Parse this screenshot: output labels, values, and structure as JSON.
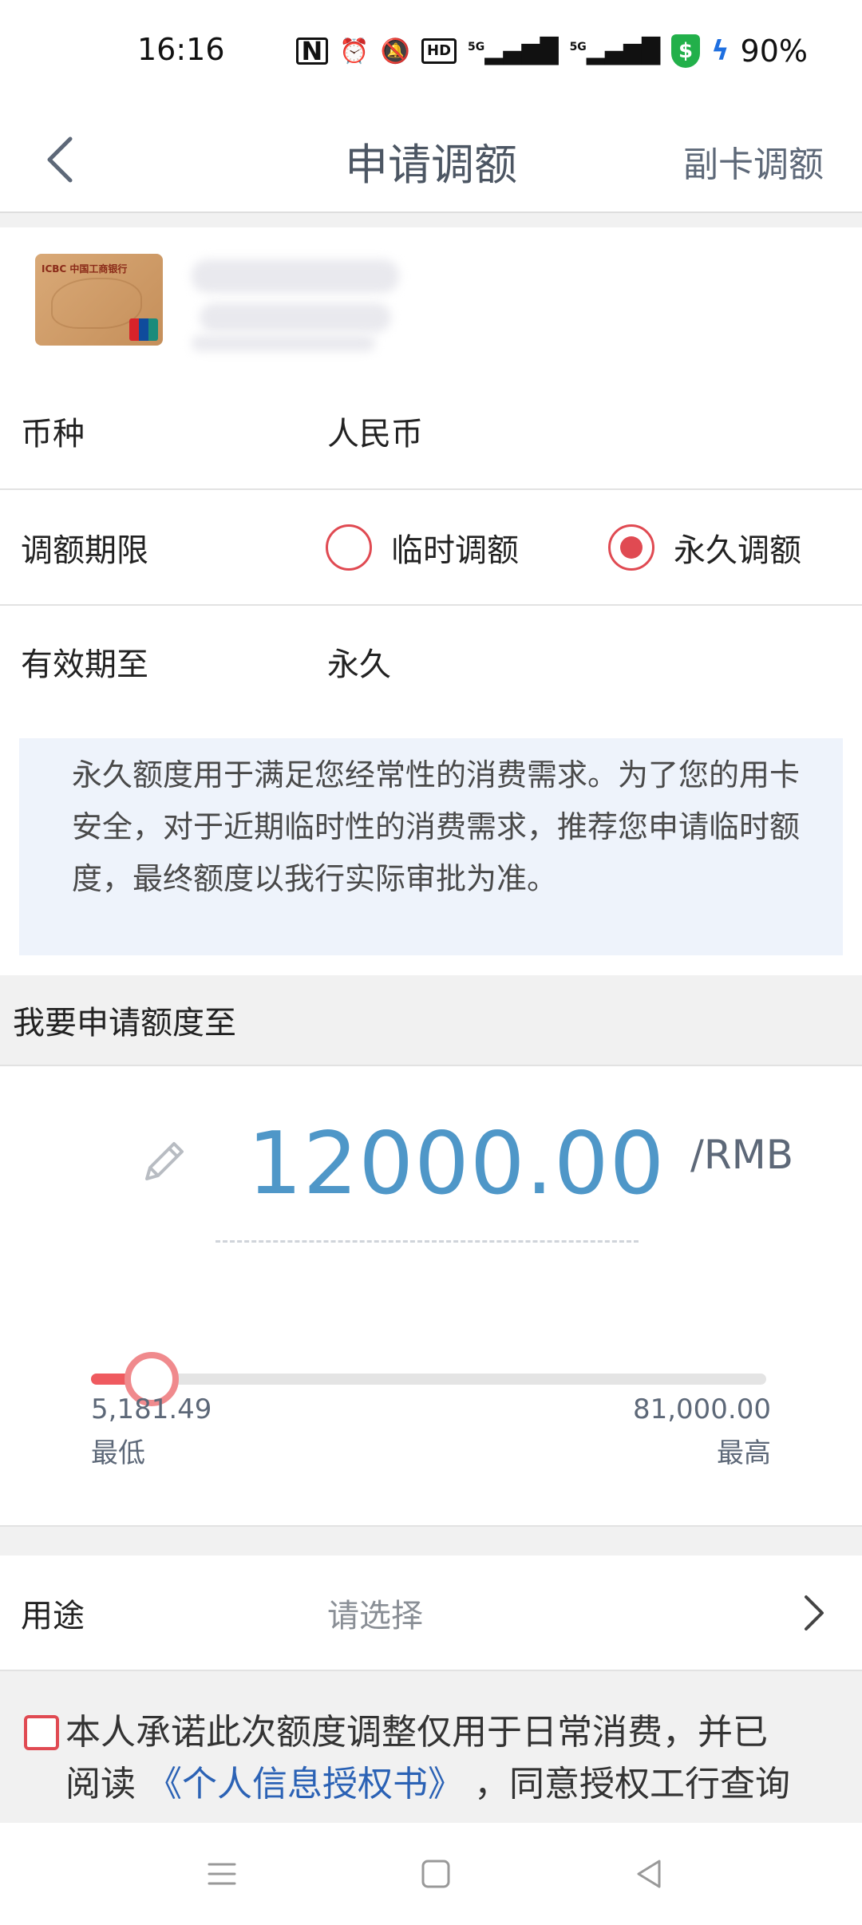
{
  "status_bar": {
    "time": "16:16",
    "icons": [
      "nfc-icon",
      "alarm-icon",
      "mute-icon",
      "hd-icon",
      "5g-signal-icon",
      "5g-signal-icon",
      "security-shield-icon",
      "charging-icon"
    ],
    "hd_label": "HD",
    "net1": "5G",
    "net2": "5G",
    "battery": "90%"
  },
  "header": {
    "title": "申请调额",
    "right_link": "副卡调额"
  },
  "card": {
    "brand_colors": [
      "#d9a977",
      "#c58f5a"
    ],
    "logo_text": "ICBC 中国工商银行"
  },
  "form": {
    "currency": {
      "label": "币种",
      "value": "人民币"
    },
    "period": {
      "label": "调额期限",
      "options": [
        {
          "label": "临时调额",
          "checked": false
        },
        {
          "label": "永久调额",
          "checked": true
        }
      ]
    },
    "valid_until": {
      "label": "有效期至",
      "value": "永久"
    }
  },
  "notice": "永久额度用于满足您经常性的消费需求。为了您的用卡安全，对于近期临时性的消费需求，推荐您申请临时额度，最终额度以我行实际审批为准。",
  "apply": {
    "section_title": "我要申请额度至",
    "amount": "12000.00",
    "unit": "/RMB",
    "slider_position": 0.09,
    "min_value": "5,181.49",
    "min_label": "最低",
    "max_value": "81,000.00",
    "max_label": "最高"
  },
  "purpose": {
    "label": "用途",
    "placeholder": "请选择"
  },
  "agreement": {
    "line1": "本人承诺此次额度调整仅用于日常消费，并已",
    "line2_prefix": "阅读 ",
    "link": "《个人信息授权书》",
    "line2_suffix": " ，同意授权工行查询"
  },
  "colors": {
    "accent_red": "#e04a52",
    "amount_blue": "#4f97c8",
    "link_blue": "#2b62b5"
  }
}
